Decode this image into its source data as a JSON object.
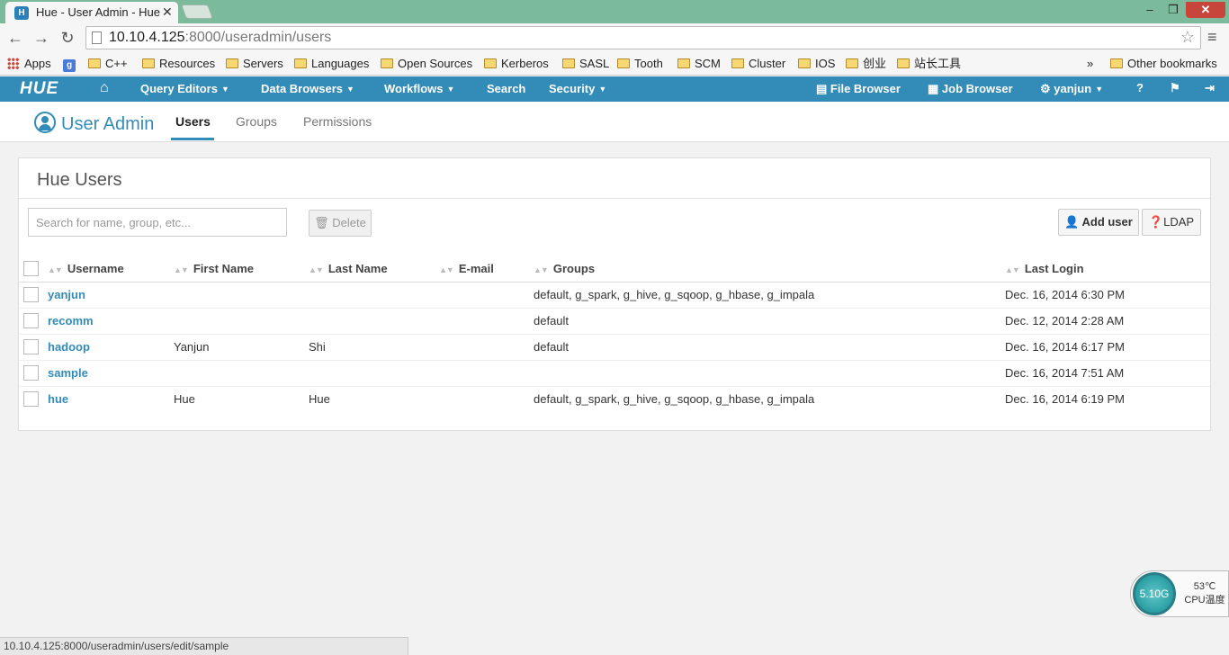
{
  "browser": {
    "tab_title": "Hue - User Admin - Hue",
    "url_host": "10.10.4.125",
    "url_rest": ":8000/useradmin/users",
    "bookmarks": [
      "Apps",
      "C++",
      "Resources",
      "Servers",
      "Languages",
      "Open Sources",
      "Kerberos",
      "SASL",
      "Tooth",
      "SCM",
      "Cluster",
      "IOS",
      "创业",
      "站长工具"
    ],
    "overflow": "»",
    "other_bookmarks": "Other bookmarks",
    "status_url": "10.10.4.125:8000/useradmin/users/edit/sample"
  },
  "hue_nav": {
    "logo": "HUE",
    "items": [
      "Query Editors",
      "Data Browsers",
      "Workflows",
      "Search",
      "Security"
    ],
    "file_browser": "File Browser",
    "job_browser": "Job Browser",
    "user": "yanjun",
    "accent": "#338bb8"
  },
  "subheader": {
    "title": "User Admin",
    "tabs": [
      "Users",
      "Groups",
      "Permissions"
    ],
    "active_tab": "Users"
  },
  "card": {
    "title": "Hue Users",
    "search_placeholder": "Search for name, group, etc...",
    "delete_label": "Delete",
    "add_user_label": "Add user",
    "ldap_label": "LDAP"
  },
  "table": {
    "columns": [
      "Username",
      "First Name",
      "Last Name",
      "E-mail",
      "Groups",
      "Last Login"
    ],
    "rows": [
      {
        "username": "yanjun",
        "first": "",
        "last": "",
        "email": "",
        "groups": "default, g_spark, g_hive, g_sqoop, g_hbase, g_impala",
        "last_login": "Dec. 16, 2014 6:30 PM"
      },
      {
        "username": "recomm",
        "first": "",
        "last": "",
        "email": "",
        "groups": "default",
        "last_login": "Dec. 12, 2014 2:28 AM"
      },
      {
        "username": "hadoop",
        "first": "Yanjun",
        "last": "Shi",
        "email": "",
        "groups": "default",
        "last_login": "Dec. 16, 2014 6:17 PM"
      },
      {
        "username": "sample",
        "first": "",
        "last": "",
        "email": "",
        "groups": "",
        "last_login": "Dec. 16, 2014 7:51 AM"
      },
      {
        "username": "hue",
        "first": "Hue",
        "last": "Hue",
        "email": "",
        "groups": "default, g_spark, g_hive, g_sqoop, g_hbase, g_impala",
        "last_login": "Dec. 16, 2014 6:19 PM"
      }
    ]
  },
  "widget": {
    "memory": "5.10G",
    "temp": "53℃",
    "label": "CPU温度"
  }
}
